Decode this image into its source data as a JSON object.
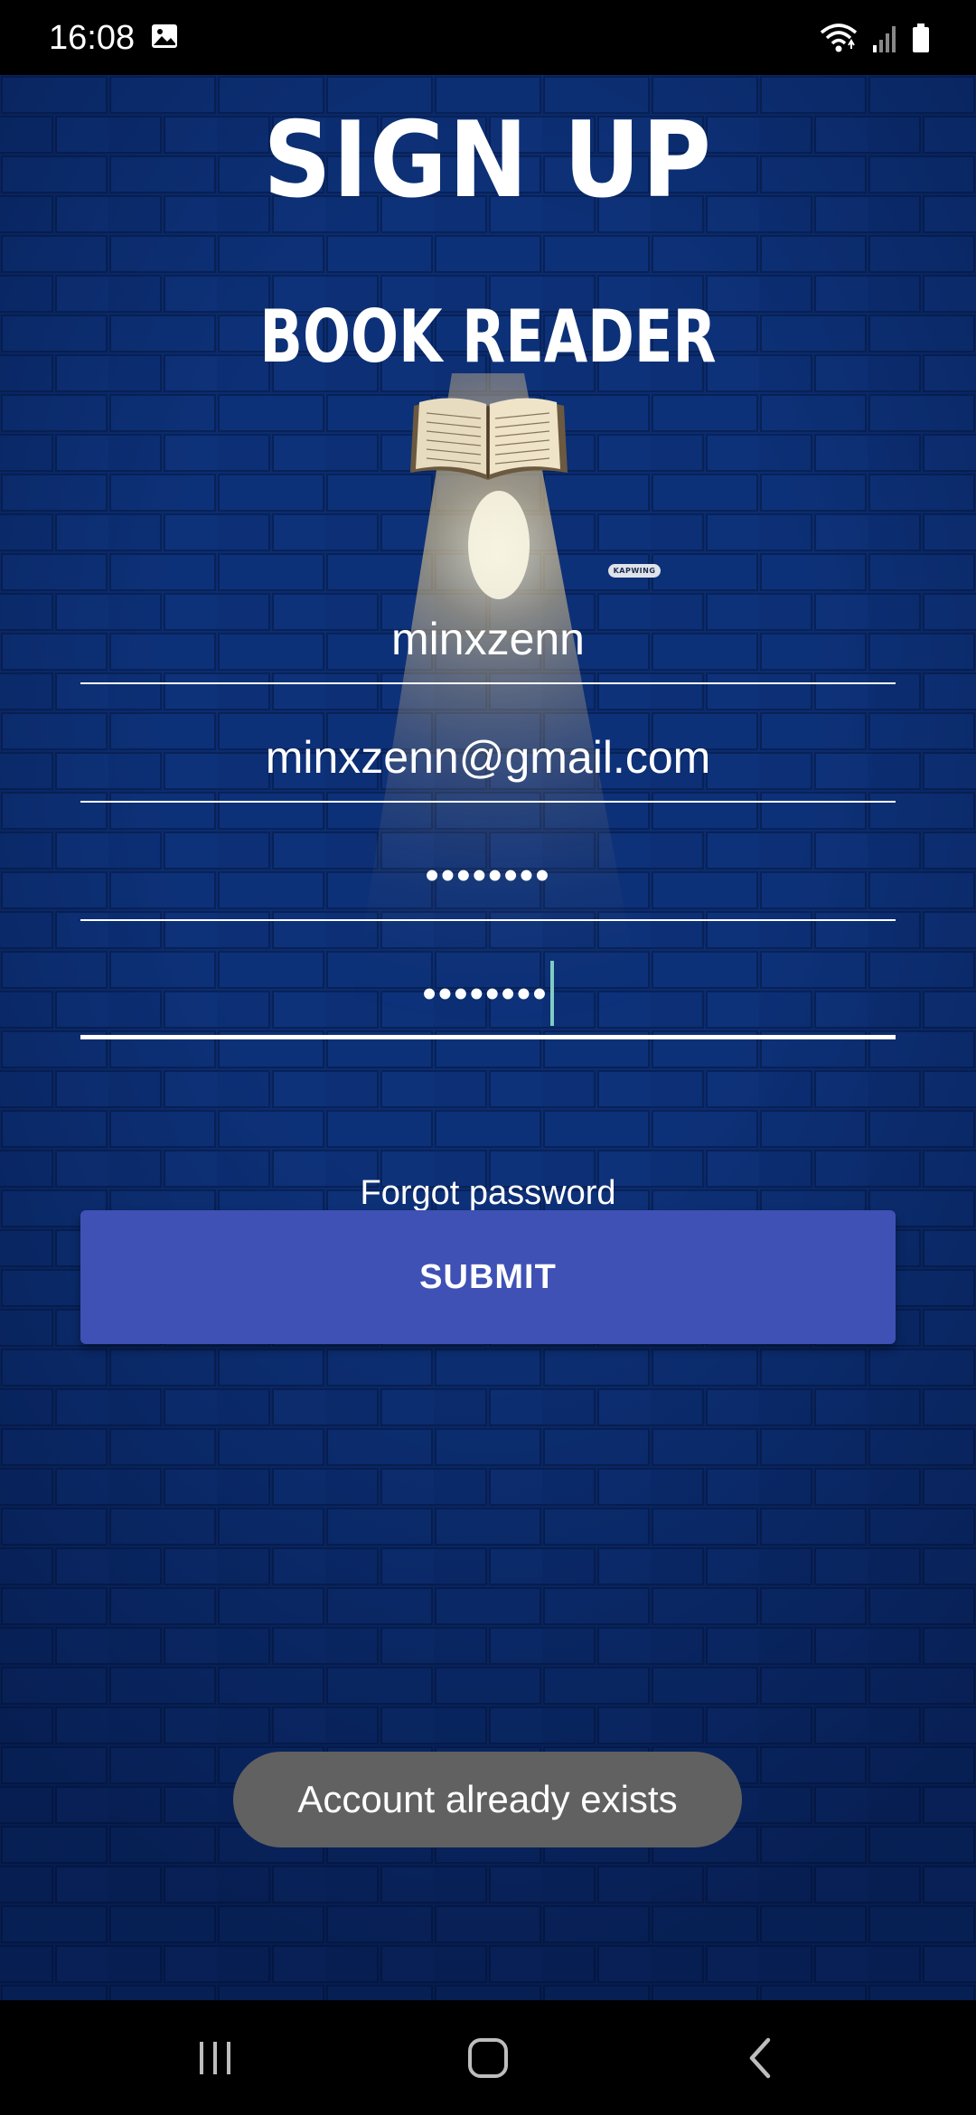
{
  "status_bar": {
    "time": "16:08",
    "icons": [
      "gallery-icon",
      "wifi-icon",
      "signal-icon",
      "battery-icon"
    ]
  },
  "header": {
    "title": "SIGN UP",
    "app_name": "BOOK READER",
    "logo_icon": "open-book-icon",
    "watermark": "KAPWING"
  },
  "form": {
    "username_value": "minxzenn",
    "email_value": "minxzenn@gmail.com",
    "password_value": "••••••••",
    "confirm_password_value": "••••••••",
    "forgot_password_label": "Forgot password",
    "submit_label": "SUBMIT"
  },
  "toast": {
    "message": "Account already exists"
  },
  "navigation": {
    "buttons": [
      "recent-apps-icon",
      "home-icon",
      "back-icon"
    ]
  },
  "colors": {
    "background": "#0a2a6e",
    "button": "#3f51b5",
    "toast": "#616161",
    "caret": "#80cbc4"
  }
}
